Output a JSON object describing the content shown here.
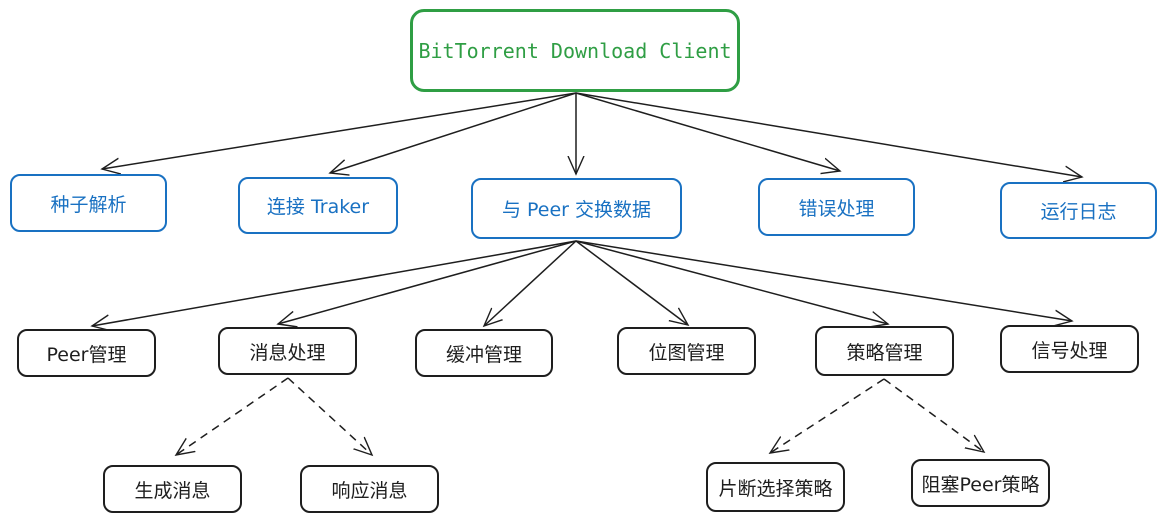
{
  "root": {
    "label": "BitTorrent Download Client"
  },
  "level1": [
    {
      "id": "torrent",
      "label": "种子解析"
    },
    {
      "id": "tracker",
      "label": "连接 Traker"
    },
    {
      "id": "peer",
      "label": "与 Peer 交换数据"
    },
    {
      "id": "error",
      "label": "错误处理"
    },
    {
      "id": "log",
      "label": "运行日志"
    }
  ],
  "level2": [
    {
      "id": "peer-mgmt",
      "label": "Peer管理"
    },
    {
      "id": "msg",
      "label": "消息处理"
    },
    {
      "id": "buffer",
      "label": "缓冲管理"
    },
    {
      "id": "bitmap",
      "label": "位图管理"
    },
    {
      "id": "strategy",
      "label": "策略管理"
    },
    {
      "id": "signal",
      "label": "信号处理"
    }
  ],
  "level3": [
    {
      "id": "gen-msg",
      "label": "生成消息"
    },
    {
      "id": "resp-msg",
      "label": "响应消息"
    },
    {
      "id": "piece-select",
      "label": "片断选择策略"
    },
    {
      "id": "choke",
      "label": "阻塞Peer策略"
    }
  ],
  "colors": {
    "root": "#2f9e44",
    "level1": "#1971c2",
    "default": "#1e1e1e"
  }
}
